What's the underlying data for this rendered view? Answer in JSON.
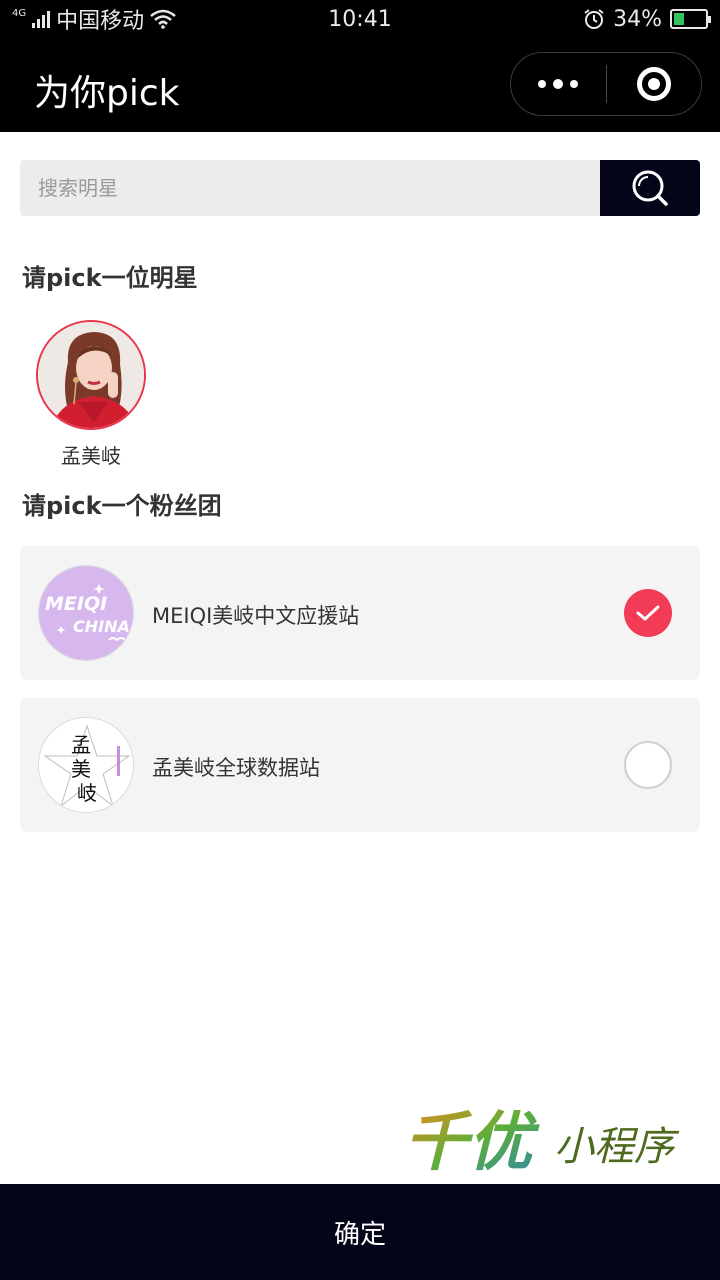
{
  "status_bar": {
    "network": "4G",
    "carrier": "中国移动",
    "time": "10:41",
    "battery_percent": "34%",
    "battery_level": 0.34
  },
  "nav": {
    "title": "为你pick"
  },
  "search": {
    "placeholder": "搜索明星"
  },
  "star_section": {
    "title": "请pick一位明星",
    "stars": [
      {
        "name": "孟美岐",
        "selected": true
      }
    ]
  },
  "group_section": {
    "title": "请pick一个粉丝团",
    "groups": [
      {
        "name": "MEIQI美岐中文应援站",
        "selected": true,
        "logo_text": [
          "MEIQI",
          "CHINA"
        ]
      },
      {
        "name": "孟美岐全球数据站",
        "selected": false,
        "logo_text": [
          "孟",
          "美",
          "岐"
        ]
      }
    ]
  },
  "watermark": {
    "text": [
      "千优",
      "小程序"
    ]
  },
  "confirm_label": "确定",
  "colors": {
    "accent_red": "#f23b57",
    "dark_navy": "#05051a",
    "card_bg": "#f4f4f4"
  }
}
